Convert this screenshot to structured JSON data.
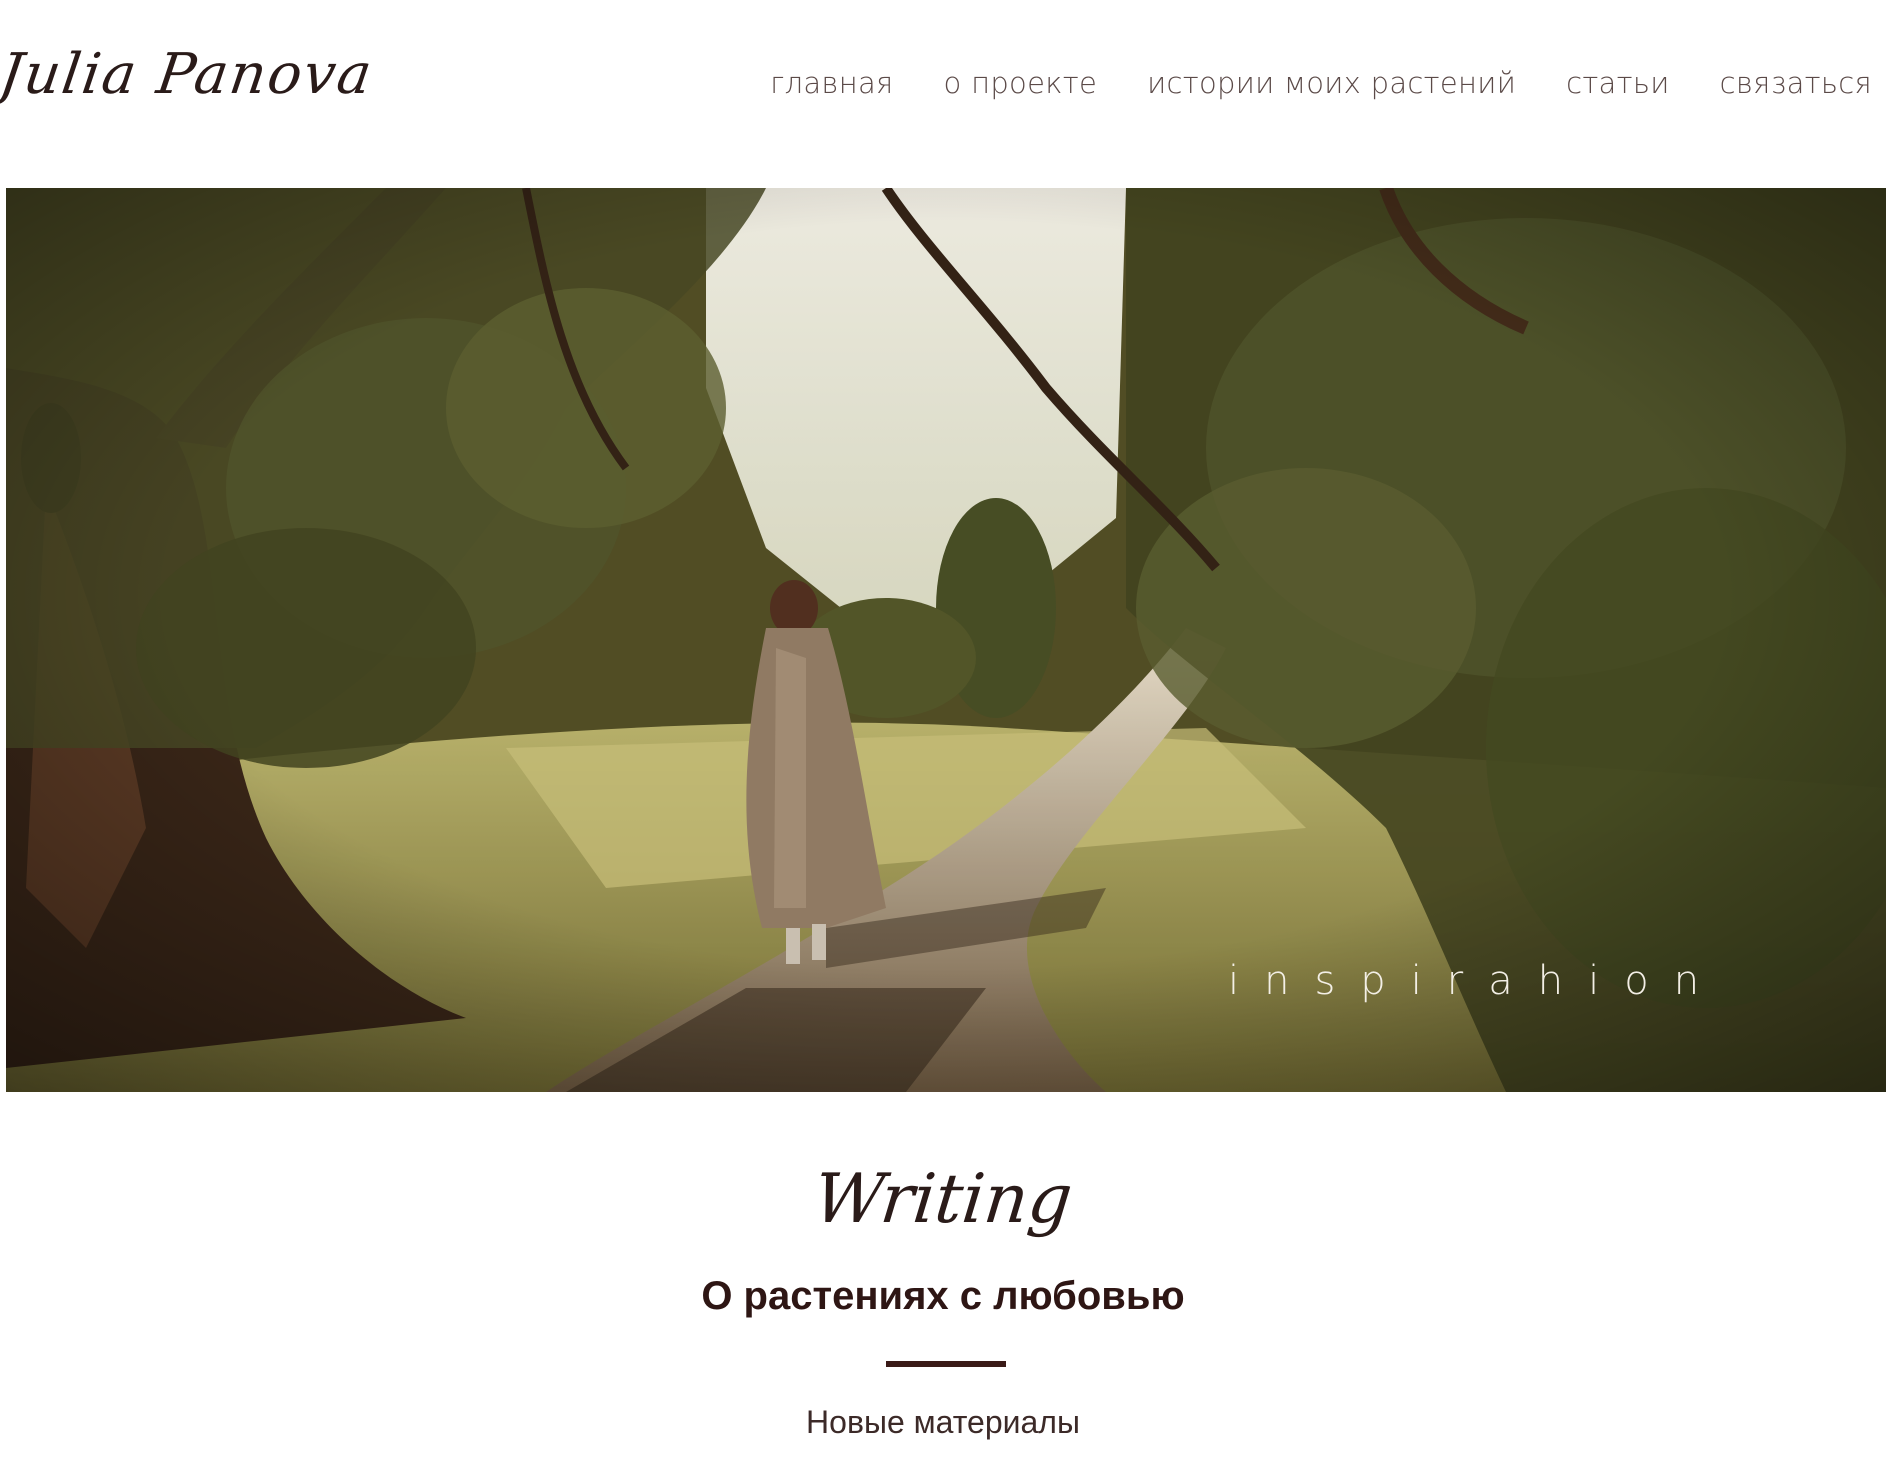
{
  "header": {
    "logo_text": "Julia Panova",
    "nav": [
      {
        "label": "главная"
      },
      {
        "label": "о проекте"
      },
      {
        "label": "истории моих растений"
      },
      {
        "label": "статьи"
      },
      {
        "label": "связаться"
      }
    ]
  },
  "hero": {
    "caption": "inspirahion"
  },
  "section": {
    "script_title": "Writing",
    "headline": "О растениях с любовью",
    "subhead": "Новые материалы"
  },
  "colors": {
    "text_dark": "#2a1b19",
    "divider": "#3a1a17",
    "nav_text": "#5b4a48"
  }
}
